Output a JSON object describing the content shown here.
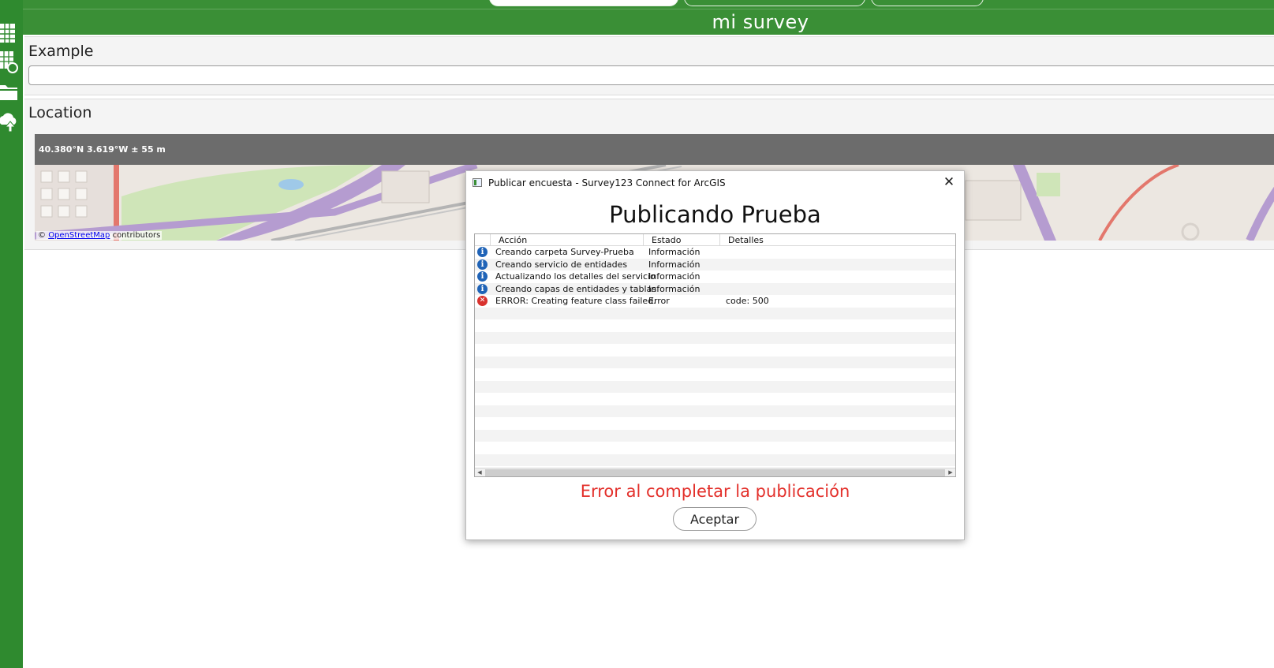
{
  "header": {
    "survey_title": "mi survey"
  },
  "sidebar": {
    "icons": [
      "spreadsheet-icon",
      "spreadsheet-sync-icon",
      "folder-icon",
      "publish-upload-icon"
    ]
  },
  "form": {
    "example": {
      "label": "Example",
      "value": ""
    },
    "location": {
      "label": "Location",
      "coordinates": "40.380°N  3.619°W  ± 55 m",
      "attribution_prefix": "© ",
      "attribution_link": "OpenStreetMap",
      "attribution_suffix": " contributors"
    }
  },
  "dialog": {
    "window_title": "Publicar encuesta - Survey123 Connect for ArcGIS",
    "heading": "Publicando Prueba",
    "columns": [
      "Acción",
      "Estado",
      "Detalles"
    ],
    "rows": [
      {
        "type": "info",
        "accion": "Creando carpeta Survey-Prueba",
        "estado": "Información",
        "detalles": ""
      },
      {
        "type": "info",
        "accion": "Creando servicio de entidades",
        "estado": "Información",
        "detalles": ""
      },
      {
        "type": "info",
        "accion": "Actualizando los detalles del servicio",
        "estado": "Información",
        "detalles": ""
      },
      {
        "type": "info",
        "accion": "Creando capas de entidades y tablas",
        "estado": "Información",
        "detalles": ""
      },
      {
        "type": "error",
        "accion": "ERROR: Creating feature class failed.",
        "estado": "Error",
        "detalles": "code: 500"
      }
    ],
    "error_message": "Error al completar la publicación",
    "accept_label": "Aceptar"
  },
  "colors": {
    "header_green": "#3a8f36",
    "sidebar_green": "#2f8a2f",
    "error_red": "#e3302b",
    "info_blue": "#1f63b7"
  }
}
